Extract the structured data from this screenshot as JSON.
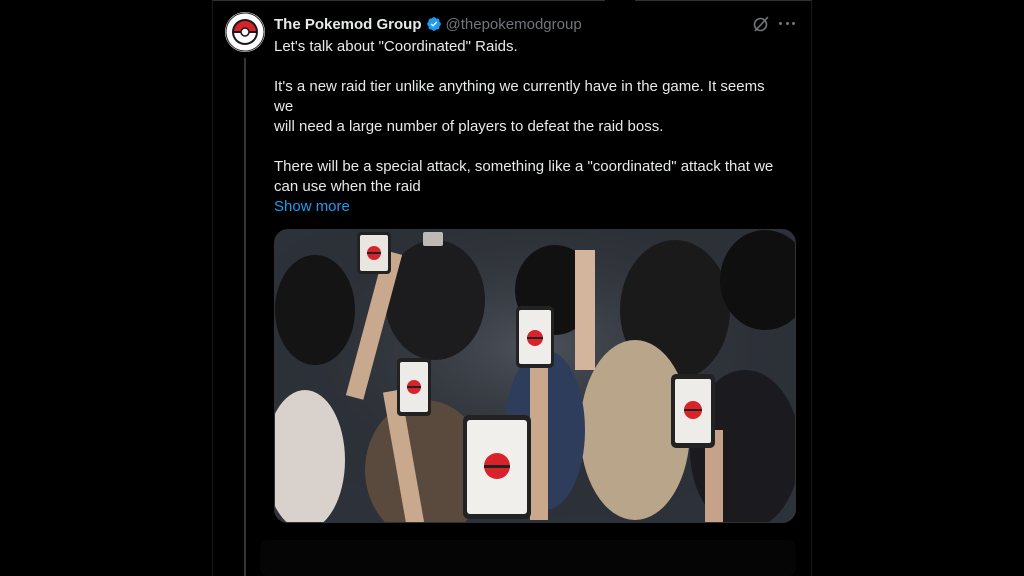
{
  "author": {
    "name": "The Pokemod Group",
    "handle": "@thepokemodgroup"
  },
  "tweet": {
    "lines": [
      "Let's talk about \"Coordinated\" Raids.",
      "",
      "It's a new raid tier unlike anything we currently have in the game. It seems",
      "we",
      "will need a large number of players to defeat the raid boss.",
      "",
      "There will be a special attack, something like a \"coordinated\" attack that we",
      "can use when the raid"
    ],
    "show_more": "Show more"
  },
  "icons": {
    "verified": "verified-badge-icon",
    "grok": "grok-icon",
    "more": "more-options-icon"
  },
  "colors": {
    "background": "#000000",
    "text": "#e7e9ea",
    "secondary": "#71767b",
    "accent": "#1d9bf0",
    "verified": "#1d9bf0"
  }
}
